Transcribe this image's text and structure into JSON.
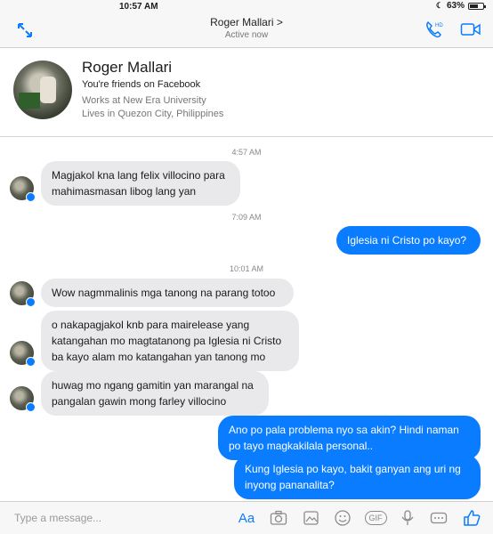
{
  "status_bar": {
    "time": "10:57 AM",
    "battery": "63%",
    "battery_level": 0.63
  },
  "header": {
    "title": "Roger Mallari",
    "chevron": ">",
    "subtitle": "Active now",
    "icons": [
      "expand-icon",
      "voice-call-icon",
      "video-call-icon"
    ]
  },
  "profile": {
    "name": "Roger Mallari",
    "friends": "You're friends on Facebook",
    "work": "Works at New Era University",
    "location": "Lives in Quezon City, Philippines"
  },
  "timestamps": [
    "4:57 AM",
    "7:09 AM",
    "10:01 AM"
  ],
  "messages": [
    {
      "from": "them",
      "text": "Magjakol kna lang felix villocino para mahimasmasan libog lang yan"
    },
    {
      "from": "me",
      "text": "Iglesia ni Cristo po kayo?"
    },
    {
      "from": "them",
      "text": "Wow nagmmalinis mga tanong na parang totoo"
    },
    {
      "from": "them",
      "text": "o nakapagjakol knb para mairelease yang katangahan mo magtatanong pa Iglesia ni Cristo ba kayo alam mo katangahan yan tanong mo"
    },
    {
      "from": "them",
      "text": "huwag mo ngang gamitin yan marangal na pangalan gawin mong farley villocino"
    },
    {
      "from": "me",
      "text": "Ano po pala problema nyo sa akin? Hindi naman po tayo magkakilala personal.."
    },
    {
      "from": "me",
      "text": "Kung Iglesia po kayo, bakit ganyan ang uri ng inyong pananalita?"
    }
  ],
  "compose": {
    "placeholder": "Type a message...",
    "aa_label": "Aa",
    "gif_label": "GIF",
    "tools": [
      "text-format-icon",
      "camera-icon",
      "photo-icon",
      "emoji-icon",
      "gif-icon",
      "microphone-icon",
      "more-icon",
      "like-icon"
    ]
  },
  "colors": {
    "accent": "#0a7cff",
    "incoming_bubble": "#e9e9eb",
    "bar": "#f7f7f7"
  }
}
